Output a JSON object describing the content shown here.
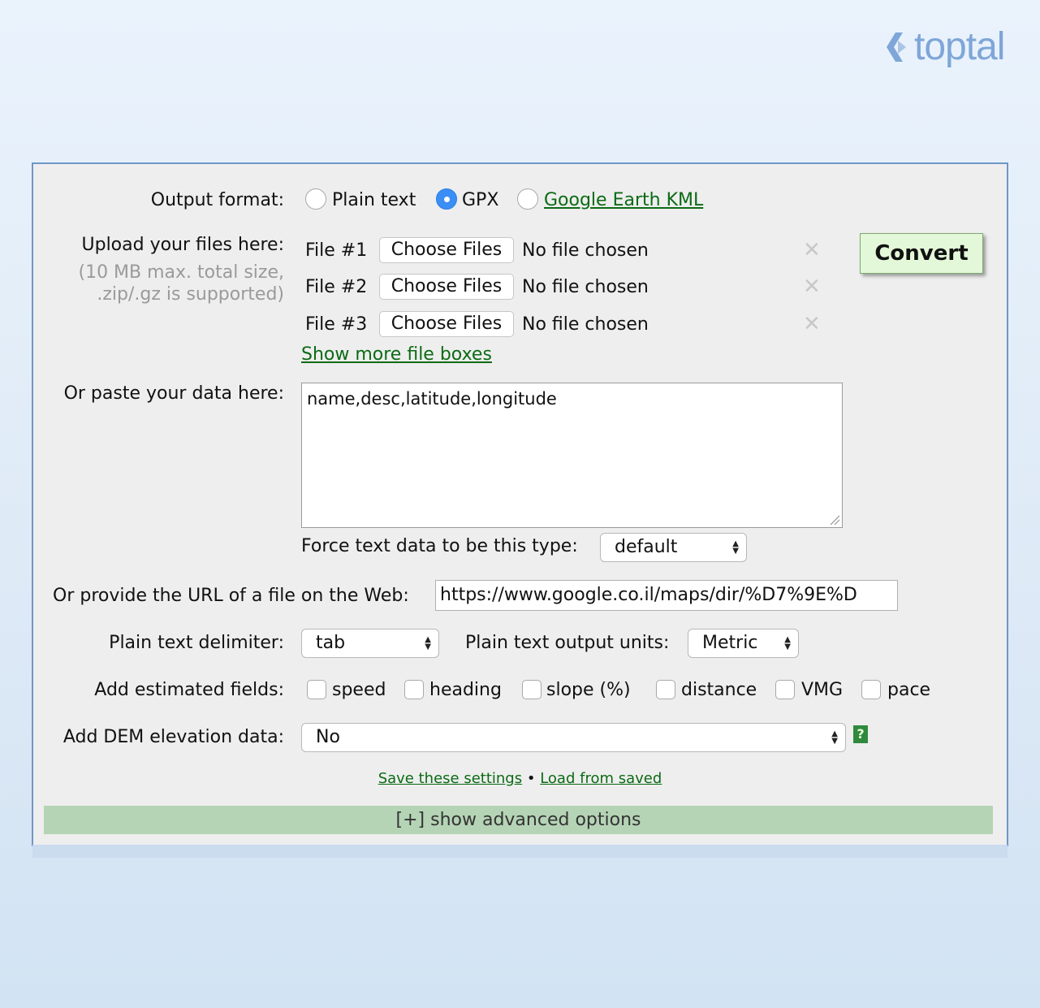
{
  "brand": {
    "name": "toptal",
    "color": "#7fa6d8",
    "icon": "toptal-logo-icon"
  },
  "output_format": {
    "label": "Output format:",
    "options": [
      {
        "label": "Plain text",
        "selected": false
      },
      {
        "label": "GPX",
        "selected": true
      },
      {
        "label": "Google Earth KML",
        "selected": false,
        "link": true
      }
    ]
  },
  "upload": {
    "label": "Upload your files here:",
    "note_line1": "(10 MB max. total size,",
    "note_line2": ".zip/.gz is supported)",
    "files": [
      {
        "label": "File #1",
        "button": "Choose Files",
        "status": "No file chosen"
      },
      {
        "label": "File #2",
        "button": "Choose Files",
        "status": "No file chosen"
      },
      {
        "label": "File #3",
        "button": "Choose Files",
        "status": "No file chosen"
      }
    ],
    "remove_icon": "close-icon",
    "more_link": "Show more file boxes"
  },
  "convert_button": "Convert",
  "paste": {
    "label": "Or paste your data here:",
    "value": "name,desc,latitude,longitude",
    "force_label": "Force text data to be this type:",
    "force_value": "default"
  },
  "url": {
    "label": "Or provide the URL of a file on the Web:",
    "value": "https://www.google.co.il/maps/dir/%D7%9E%D"
  },
  "delimiter": {
    "label": "Plain text delimiter:",
    "value": "tab"
  },
  "units": {
    "label": "Plain text output units:",
    "value": "Metric"
  },
  "estimated": {
    "label": "Add estimated fields:",
    "fields": [
      {
        "label": "speed",
        "checked": false
      },
      {
        "label": "heading",
        "checked": false
      },
      {
        "label": "slope (%)",
        "checked": false
      },
      {
        "label": "distance",
        "checked": false
      },
      {
        "label": "VMG",
        "checked": false
      },
      {
        "label": "pace",
        "checked": false
      }
    ]
  },
  "dem": {
    "label": "Add DEM elevation data:",
    "value": "No",
    "help_icon": "question-icon",
    "help_text": "?"
  },
  "settings": {
    "save": "Save these settings",
    "separator": "•",
    "load": "Load from saved"
  },
  "advanced": "[+] show advanced options",
  "colors": {
    "panel_border": "#6f97c6",
    "link": "#0b6b14",
    "convert_bg": "#e3f8d8",
    "advanced_bar": "#b5d4b6",
    "radio_selected": "#3a8ef5"
  }
}
